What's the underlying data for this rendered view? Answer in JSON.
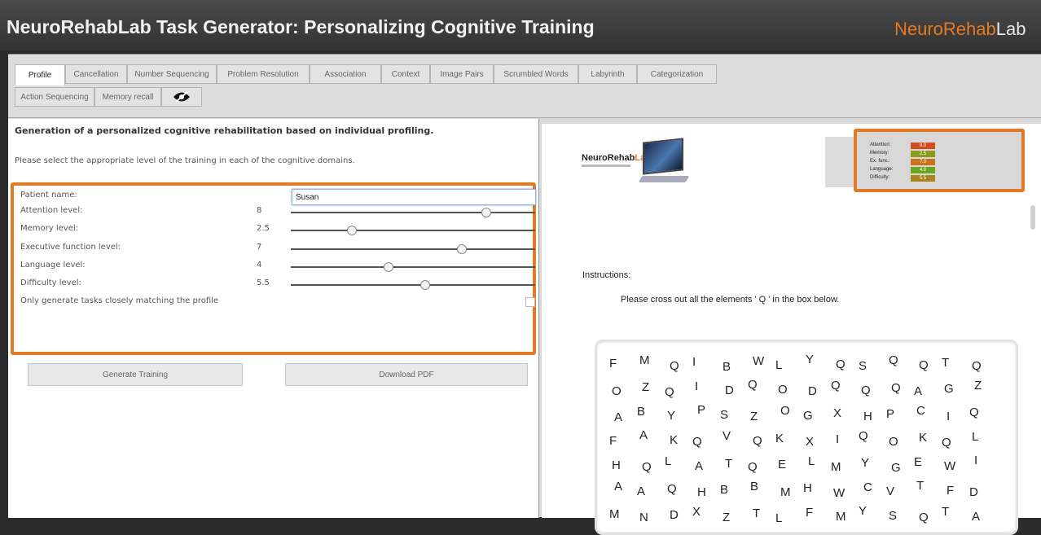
{
  "window": {
    "title": "NeuroRehabLab Task Generator: Personalizing Cognitive Training",
    "brand_part1": "Neuro",
    "brand_part2": "Rehab",
    "brand_part3": "Lab"
  },
  "tabs": [
    {
      "label": "Profile",
      "active": true
    },
    {
      "label": "Cancellation"
    },
    {
      "label": "Number Sequencing"
    },
    {
      "label": "Problem Resolution"
    },
    {
      "label": "Association"
    },
    {
      "label": "Context"
    },
    {
      "label": "Image Pairs"
    },
    {
      "label": "Scrumbled Words"
    },
    {
      "label": "Labyrinth"
    },
    {
      "label": "Categorization"
    },
    {
      "label": "Action Sequencing"
    },
    {
      "label": "Memory recall"
    },
    {
      "label": "",
      "icon": "eye-icon"
    }
  ],
  "left": {
    "heading": "Generation of a personalized cognitive rehabilitation based on individual profiling.",
    "subtext": "Please select the appropriate level of the training in each of the cognitive domains."
  },
  "profile": {
    "patient_label": "Patient name:",
    "patient_value": "Susan",
    "sliders": [
      {
        "label": "Attention level:",
        "value": "8",
        "level": 8,
        "min": 0,
        "max": 10
      },
      {
        "label": "Memory level:",
        "value": "2.5",
        "level": 2.5,
        "min": 0,
        "max": 10
      },
      {
        "label": "Executive function level:",
        "value": "7",
        "level": 7,
        "min": 0,
        "max": 10
      },
      {
        "label": "Language level:",
        "value": "4",
        "level": 4,
        "min": 0,
        "max": 10
      },
      {
        "label": "Difficulty level:",
        "value": "5.5",
        "level": 5.5,
        "min": 0,
        "max": 10
      }
    ],
    "checkbox_label": "Only generate tasks closely matching the profile",
    "checkbox_checked": false
  },
  "buttons": {
    "generate": "Generate Training",
    "download": "Download PDF"
  },
  "right": {
    "logo_part1": "NeuroRehab",
    "logo_part2": "Lab",
    "stats": [
      {
        "label": "Attention:",
        "value": "8.0",
        "color": "#d9491e"
      },
      {
        "label": "Memory:",
        "value": "2.5",
        "color": "#8a9b1e"
      },
      {
        "label": "Ex. func.:",
        "value": "7.0",
        "color": "#c9741c"
      },
      {
        "label": "Language:",
        "value": "4.0",
        "color": "#6aa61e"
      },
      {
        "label": "Difficulty:",
        "value": "5.5",
        "color": "#a6861c"
      }
    ],
    "instructions_label": "Instructions:",
    "instructions_text": "Please cross out all the elements ' Q ' in the box below.",
    "letter_rows": [
      [
        "F",
        "M",
        "Q",
        "I",
        "B",
        "W",
        "L",
        "Y",
        "Q",
        "S",
        "Q",
        "Q",
        "T",
        "Q"
      ],
      [
        "O",
        "Z",
        "Q",
        "I",
        "D",
        "Q",
        "O",
        "D",
        "Q",
        "Q",
        "Q",
        "A",
        "G",
        "Z"
      ],
      [
        "A",
        "B",
        "Y",
        "P",
        "S",
        "Z",
        "O",
        "G",
        "X",
        "H",
        "P",
        "C",
        "I",
        "Q"
      ],
      [
        "F",
        "A",
        "K",
        "Q",
        "V",
        "Q",
        "K",
        "X",
        "I",
        "Q",
        "O",
        "K",
        "Q",
        "L"
      ],
      [
        "H",
        "Q",
        "L",
        "A",
        "T",
        "Q",
        "E",
        "L",
        "M",
        "Y",
        "G",
        "E",
        "W",
        "I"
      ],
      [
        "A",
        "A",
        "Q",
        "H",
        "B",
        "B",
        "M",
        "H",
        "W",
        "C",
        "V",
        "T",
        "F",
        "D"
      ],
      [
        "M",
        "N",
        "D",
        "X",
        "Z",
        "T",
        "L",
        "F",
        "M",
        "Y",
        "S",
        "Q",
        "T",
        "A"
      ]
    ]
  },
  "colors": {
    "highlight": "#e27a24",
    "brand_orange": "#e87a1e"
  }
}
